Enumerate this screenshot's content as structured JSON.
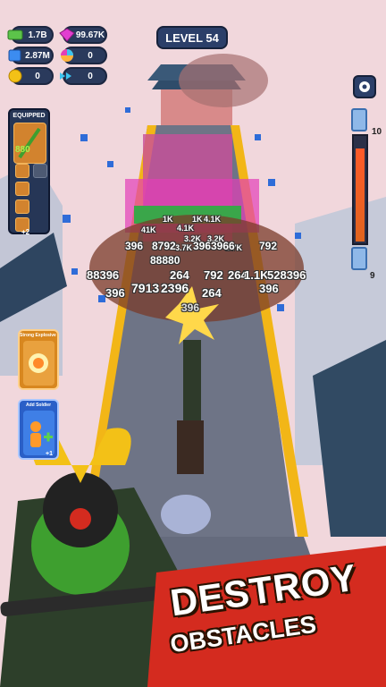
{
  "hud": {
    "cash": "1.7B",
    "gems": "99.67K",
    "blue_gems": "2.87M",
    "spins": "0",
    "coins": "0",
    "arrows": "0",
    "level": "LEVEL 54"
  },
  "equipped": {
    "title": "EQUIPPED",
    "weapon_value": "880",
    "slot_badge": "+2"
  },
  "cards": [
    {
      "title": "Strong Explosive Sh...",
      "color": "#2a5fc7"
    },
    {
      "title": "Add Soldier",
      "color": "#2a5fc7",
      "badge": "+1"
    }
  ],
  "power_meter": {
    "top": "10",
    "bottom": "9",
    "fill_fraction": 0.9
  },
  "damage_numbers": [
    "1K",
    "1K",
    "4.1K",
    "4.1K",
    "41K",
    "3.2K",
    "3.2K",
    "396",
    "3.7K",
    "3.7K",
    "8792",
    "396",
    "3966",
    "792",
    "88880",
    "88396",
    "264",
    "792",
    "264",
    "1.1K",
    "528396",
    "396",
    "7913",
    "2396",
    "264",
    "396",
    "396"
  ],
  "banner": {
    "line1": "DESTROY",
    "line2": "OBSTACLES"
  },
  "colors": {
    "road": "#6e7486",
    "rail": "#f2b617",
    "banner_red": "#d42b1f",
    "armor_green": "#3e9f2f",
    "gold": "#f3c117"
  }
}
